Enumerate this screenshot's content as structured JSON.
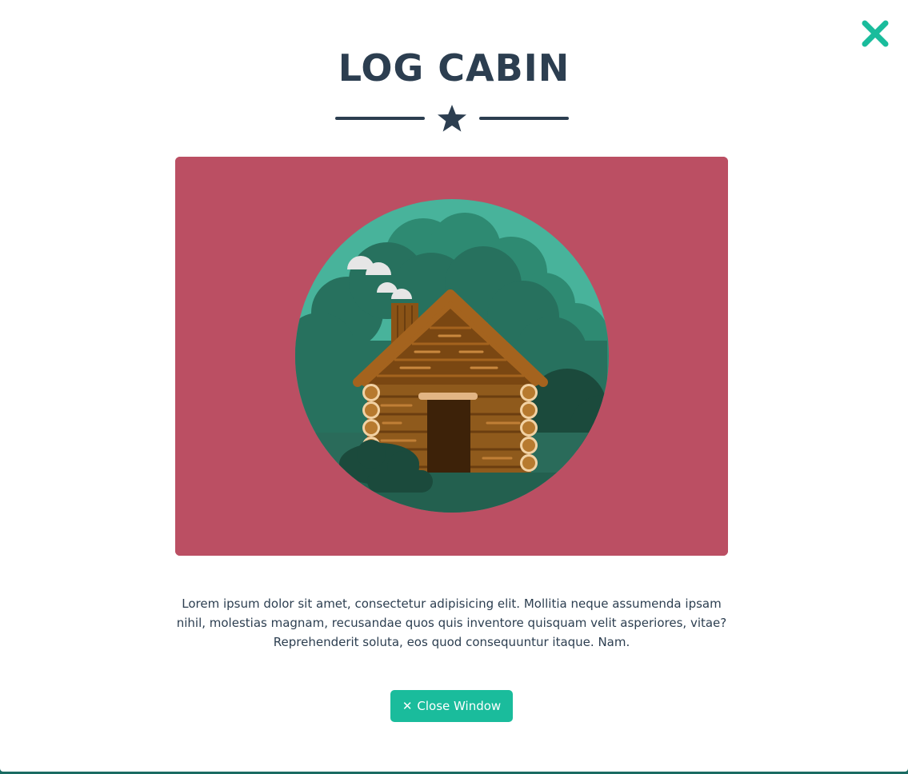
{
  "modal": {
    "title": "LOG CABIN",
    "description": "Lorem ipsum dolor sit amet, consectetur adipisicing elit. Mollitia neque assumenda ipsam nihil, molestias magnam, recusandae quos quis inventore quisquam velit asperiores, vitae? Reprehenderit soluta, eos quod consequuntur itaque. Nam.",
    "close_button_label": "Close Window",
    "close_button_icon": "✕"
  },
  "icons": {
    "close": "close-icon",
    "divider": "star-icon",
    "illustration": "log-cabin-illustration"
  },
  "colors": {
    "title": "#2c3e50",
    "accent": "#1abc9c",
    "image_background": "#bb4f63",
    "text": "#2c3e50"
  }
}
